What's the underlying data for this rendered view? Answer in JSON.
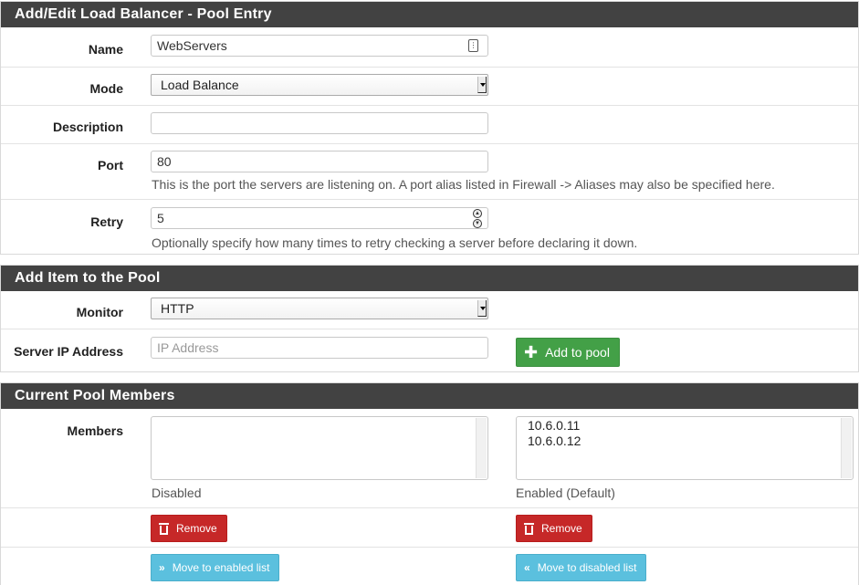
{
  "pool_entry": {
    "heading": "Add/Edit Load Balancer - Pool Entry",
    "name_label": "Name",
    "name_value": "WebServers",
    "mode_label": "Mode",
    "mode_value": "Load Balance",
    "description_label": "Description",
    "description_value": "",
    "port_label": "Port",
    "port_value": "80",
    "port_help": "This is the port the servers are listening on. A port alias listed in Firewall -> Aliases may also be specified here.",
    "retry_label": "Retry",
    "retry_value": "5",
    "retry_help": "Optionally specify how many times to retry checking a server before declaring it down."
  },
  "add_item": {
    "heading": "Add Item to the Pool",
    "monitor_label": "Monitor",
    "monitor_value": "HTTP",
    "server_ip_label": "Server IP Address",
    "server_ip_placeholder": "IP Address",
    "add_button": "Add to pool"
  },
  "members": {
    "heading": "Current Pool Members",
    "members_label": "Members",
    "disabled_caption": "Disabled",
    "enabled_caption": "Enabled (Default)",
    "disabled_items": [],
    "enabled_items": [
      "10.6.0.11",
      "10.6.0.12"
    ],
    "remove_label": "Remove",
    "move_to_enabled": "Move to enabled list",
    "move_to_disabled": "Move to disabled list"
  },
  "colors": {
    "heading_bg": "#424242",
    "success": "#43a047",
    "danger": "#c62828",
    "info": "#5bc0de"
  }
}
